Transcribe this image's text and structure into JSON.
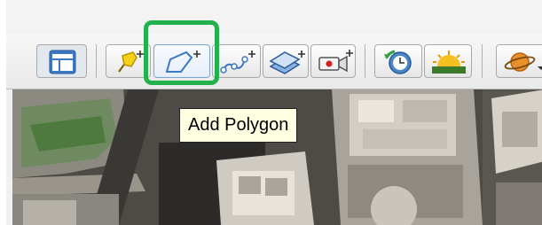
{
  "toolbar": {
    "buttons": [
      {
        "name": "sidebar-toggle",
        "icon": "sidebar-icon"
      },
      {
        "name": "add-placemark",
        "icon": "pushpin-plus-icon"
      },
      {
        "name": "add-polygon",
        "icon": "polygon-plus-icon",
        "highlighted": true
      },
      {
        "name": "add-path",
        "icon": "path-plus-icon"
      },
      {
        "name": "add-image-overlay",
        "icon": "image-overlay-plus-icon"
      },
      {
        "name": "record-tour",
        "icon": "video-camera-plus-icon"
      },
      {
        "name": "historical-imagery",
        "icon": "clock-globe-icon"
      },
      {
        "name": "sunlight",
        "icon": "sunrise-icon"
      },
      {
        "name": "switch-planet",
        "icon": "planet-icon"
      }
    ]
  },
  "tooltip": {
    "text": "Add Polygon"
  },
  "highlight_color": "#22b14c",
  "accent_color": "#3c78c3"
}
